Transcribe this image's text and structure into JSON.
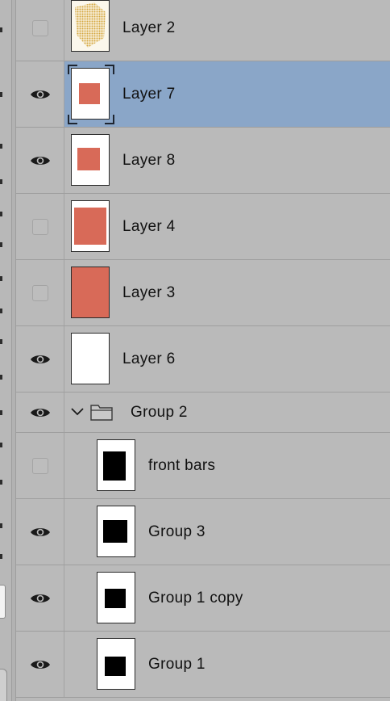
{
  "panel": "layers",
  "layers": [
    {
      "name": "Layer 2",
      "visible": false,
      "selected": false,
      "thumbnail": "sparkle-shape"
    },
    {
      "name": "Layer 7",
      "visible": true,
      "selected": true,
      "thumbnail": "small-red-square"
    },
    {
      "name": "Layer 8",
      "visible": true,
      "selected": false,
      "thumbnail": "small-red-square"
    },
    {
      "name": "Layer 4",
      "visible": false,
      "selected": false,
      "thumbnail": "large-red-square"
    },
    {
      "name": "Layer 3",
      "visible": false,
      "selected": false,
      "thumbnail": "full-red"
    },
    {
      "name": "Layer 6",
      "visible": true,
      "selected": false,
      "thumbnail": "blank-white"
    },
    {
      "name": "Group 2",
      "visible": true,
      "selected": false,
      "is_group": true,
      "expanded": true
    },
    {
      "name": "front bars",
      "visible": false,
      "selected": false,
      "thumbnail": "black-bar",
      "indented": true
    },
    {
      "name": "Group 3",
      "visible": true,
      "selected": false,
      "thumbnail": "black-square",
      "indented": true
    },
    {
      "name": "Group 1 copy",
      "visible": true,
      "selected": false,
      "thumbnail": "black-square-small",
      "indented": true
    },
    {
      "name": "Group 1",
      "visible": true,
      "selected": false,
      "thumbnail": "black-square-small",
      "indented": true
    }
  ],
  "icons": {
    "visibility": "eye-icon",
    "group": "folder-icon",
    "expand": "chevron-down-icon"
  },
  "colors": {
    "panel_bg": "#bababa",
    "selected_row": "#8aa6c8",
    "layer_red": "#d86a58",
    "sparkle_gold": "#d9b04a"
  }
}
